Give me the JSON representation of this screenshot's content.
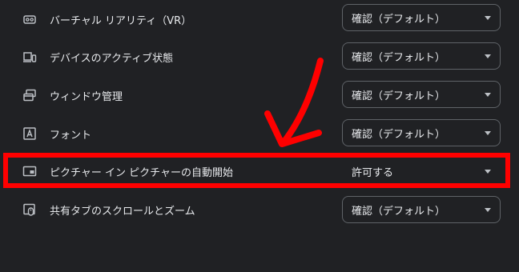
{
  "settings": {
    "rows": [
      {
        "label": "バーチャル リアリティ（VR）",
        "value": "確認（デフォルト）",
        "icon": "vr-headset-icon"
      },
      {
        "label": "デバイスのアクティブ状態",
        "value": "確認（デフォルト）",
        "icon": "devices-icon"
      },
      {
        "label": "ウィンドウ管理",
        "value": "確認（デフォルト）",
        "icon": "window-management-icon"
      },
      {
        "label": "フォント",
        "value": "確認（デフォルト）",
        "icon": "font-icon"
      },
      {
        "label": "ピクチャー イン ピクチャーの自動開始",
        "value": "許可する",
        "icon": "picture-in-picture-icon"
      },
      {
        "label": "共有タブのスクロールとズーム",
        "value": "確認（デフォルト）",
        "icon": "mouse-scroll-icon"
      }
    ]
  },
  "annotation": {
    "highlight_color": "#ff0000",
    "highlighted_row": "ピクチャー イン ピクチャーの自動開始"
  },
  "colors": {
    "background": "#202124",
    "text": "#e8eaed",
    "border": "#5f6368"
  }
}
